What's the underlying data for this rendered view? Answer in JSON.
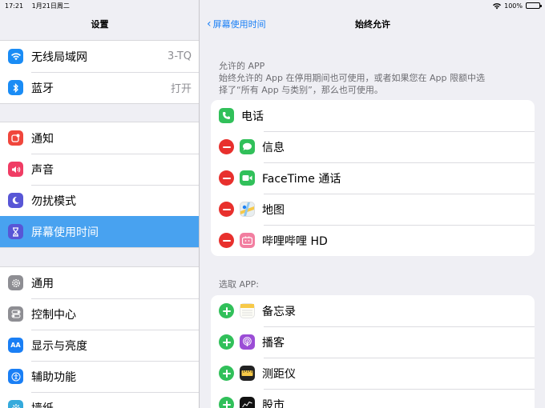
{
  "status": {
    "time": "17:21",
    "date": "1月21日周二",
    "battery": "100%"
  },
  "settings": {
    "title": "设置",
    "groups": [
      [
        {
          "label": "无线局域网",
          "value": "3-TQ",
          "icon": "wifi-icon",
          "color": "#1a8cf5"
        },
        {
          "label": "蓝牙",
          "value": "打开",
          "icon": "bluetooth-icon",
          "color": "#1a8cf5"
        }
      ],
      [
        {
          "label": "通知",
          "icon": "notifications-icon",
          "color": "#f0463c"
        },
        {
          "label": "声音",
          "icon": "sound-icon",
          "color": "#f03c64"
        },
        {
          "label": "勿扰模式",
          "icon": "moon-icon",
          "color": "#5856d6"
        },
        {
          "label": "屏幕使用时间",
          "icon": "hourglass-icon",
          "color": "#5856d6",
          "selected": true
        }
      ],
      [
        {
          "label": "通用",
          "icon": "gear-icon",
          "color": "#8e8e93"
        },
        {
          "label": "控制中心",
          "icon": "switches-icon",
          "color": "#8e8e93"
        },
        {
          "label": "显示与亮度",
          "icon": "display-icon",
          "color": "#1a7ff5"
        },
        {
          "label": "辅助功能",
          "icon": "accessibility-icon",
          "color": "#1a7ff5"
        },
        {
          "label": "墙纸",
          "icon": "wallpaper-icon",
          "color": "#35aadc"
        }
      ]
    ]
  },
  "detail": {
    "back_label": "屏幕使用时间",
    "title": "始终允许",
    "allowed_header": "允许的 APP",
    "allowed_desc_1": "始终允许的 App 在停用期间也可使用，或者如果您在 App 限额中选",
    "allowed_desc_2": "择了“所有 App 与类别”，那么也可使用。",
    "allowed": [
      {
        "label": "电话",
        "icon": "phone-icon",
        "color": "#31c05a",
        "removable": false
      },
      {
        "label": "信息",
        "icon": "messages-icon",
        "color": "#31c05a",
        "removable": true
      },
      {
        "label": "FaceTime 通话",
        "icon": "facetime-icon",
        "color": "#31c05a",
        "removable": true
      },
      {
        "label": "地图",
        "icon": "maps-icon",
        "color": "#7ec6a0",
        "removable": true
      },
      {
        "label": "哔哩哔哩 HD",
        "icon": "bilibili-icon",
        "color": "#f27ea0",
        "removable": true
      }
    ],
    "choose_header": "选取 APP:",
    "choose": [
      {
        "label": "备忘录",
        "icon": "notes-icon",
        "color": "#f7c948"
      },
      {
        "label": "播客",
        "icon": "podcasts-icon",
        "color": "#9b4dd6"
      },
      {
        "label": "测距仪",
        "icon": "measure-icon",
        "color": "#222222"
      },
      {
        "label": "股市",
        "icon": "stocks-icon",
        "color": "#111111"
      }
    ]
  }
}
